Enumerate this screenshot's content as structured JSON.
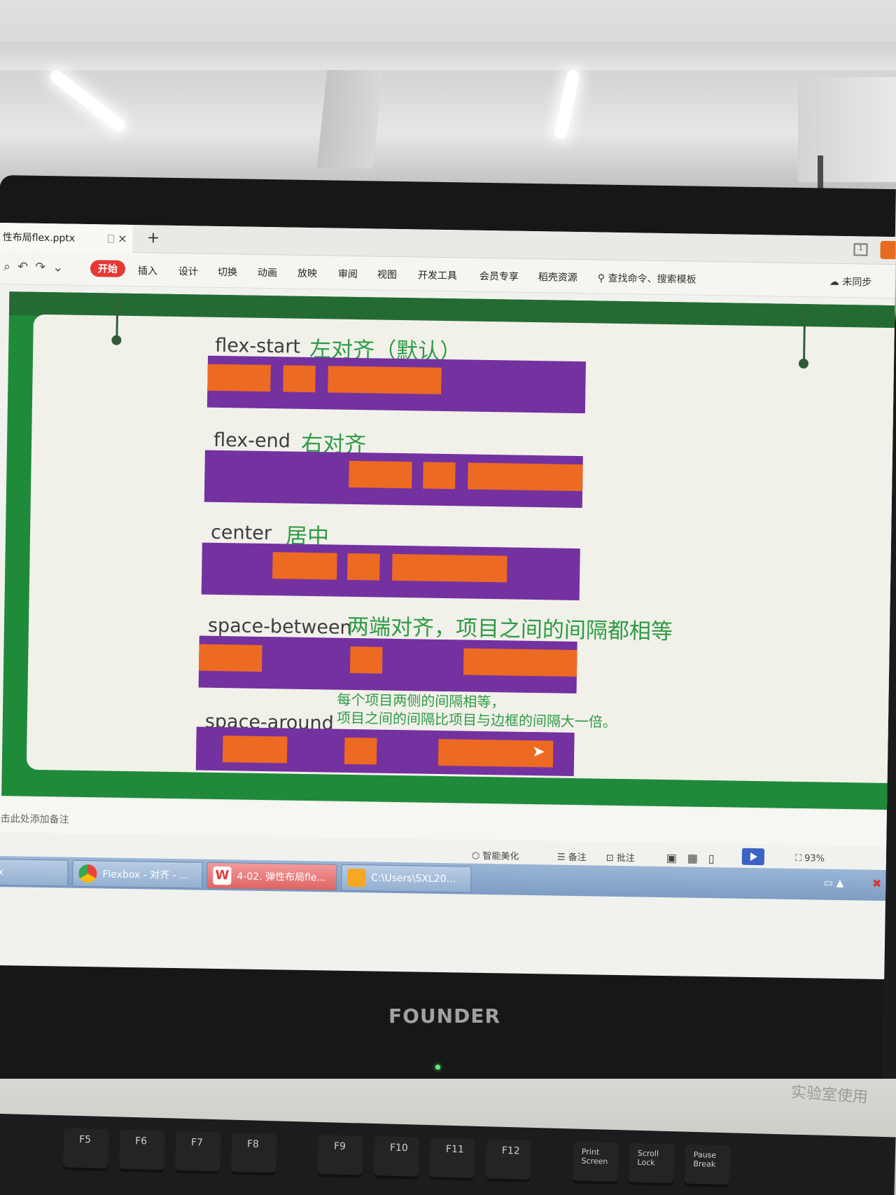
{
  "app": {
    "doc_tab": "性布局flex.pptx",
    "new_tab_symbol": "+",
    "corner_badge": "1"
  },
  "ribbon": {
    "menu": [
      "开始",
      "插入",
      "设计",
      "切换",
      "动画",
      "放映",
      "审阅",
      "视图",
      "开发工具",
      "会员专享",
      "稻壳资源"
    ],
    "search": "查找命令、搜索模板",
    "sync": "未同步"
  },
  "slide": {
    "rows": [
      {
        "label": "flex-start",
        "desc": "左对齐（默认）"
      },
      {
        "label": "flex-end",
        "desc": "右对齐"
      },
      {
        "label": "center",
        "desc": "居中"
      },
      {
        "label": "space-between",
        "desc": "两端对齐，项目之间的间隔都相等"
      },
      {
        "label": "space-around",
        "desc_line1": "每个项目两侧的间隔相等，",
        "desc_line2": "项目之间的间隔比项目与边框的间隔大一倍。"
      }
    ],
    "colors": {
      "bar": "#7431a0",
      "item": "#ed6a23",
      "frame": "#1f8a3a",
      "label_green": "#2e9b45"
    }
  },
  "notes": {
    "placeholder": "单击此处添加备注"
  },
  "status": {
    "beautify": "智能美化",
    "notes": "备注",
    "comments": "批注",
    "zoom": "93%"
  },
  "taskbar": {
    "items": [
      "lex",
      "Flexbox - 对齐 - ...",
      "4-02. 弹性布局fle...",
      "C:\\Users\\SXL20..."
    ]
  },
  "monitor": {
    "brand": "FOUNDER"
  },
  "keyboard": {
    "keys": [
      "F5",
      "F6",
      "F7",
      "F8",
      "F9",
      "F10",
      "F11",
      "F12",
      "Print Screen",
      "Scroll Lock",
      "Pause Break"
    ]
  },
  "desk": {
    "paper_text": "实验室使用"
  }
}
